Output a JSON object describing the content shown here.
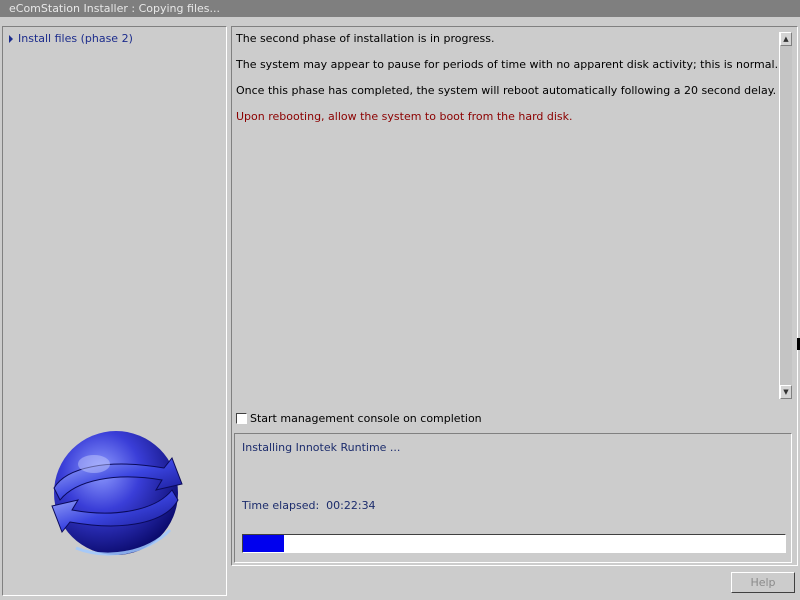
{
  "window": {
    "title": "eComStation Installer : Copying files..."
  },
  "sidebar": {
    "items": [
      {
        "label": "Install files (phase 2)"
      }
    ],
    "logo_icon": "ecomstation-globe-logo"
  },
  "main": {
    "messages": [
      "The second phase of installation is in progress.",
      "The system may appear to pause for periods of time with no apparent disk activity; this is normal.",
      "Once this phase has completed, the system will reboot automatically following a 20 second delay.",
      "Upon rebooting, allow the system to boot from the hard disk."
    ],
    "colors": {
      "normal_text": "#000000",
      "warning_text": "#8b0000"
    },
    "scroll_up_icon": "scroll-up-arrow-icon",
    "scroll_down_icon": "scroll-down-arrow-icon"
  },
  "options": {
    "checkbox_label": "Start management console on completion",
    "checkbox_checked": false
  },
  "status": {
    "current_task": "Installing Innotek Runtime ...",
    "elapsed_label": "Time elapsed:",
    "elapsed_value": "00:22:34",
    "progress_fraction": 0.076,
    "progress_color": "#0000ee"
  },
  "footer": {
    "help_label": "Help"
  }
}
